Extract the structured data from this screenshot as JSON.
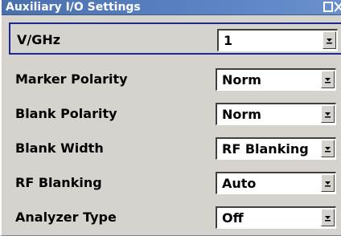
{
  "window": {
    "title": "Auxiliary I/O Settings"
  },
  "settings": [
    {
      "label": "V/GHz",
      "value": "1",
      "focused": true
    },
    {
      "label": "Marker Polarity",
      "value": "Norm",
      "focused": false
    },
    {
      "label": "Blank Polarity",
      "value": "Norm",
      "focused": false
    },
    {
      "label": "Blank Width",
      "value": "RF Blanking",
      "focused": false
    },
    {
      "label": "RF Blanking",
      "value": "Auto",
      "focused": false
    },
    {
      "label": "Analyzer Type",
      "value": "Off",
      "focused": false
    }
  ],
  "colors": {
    "titlebar": "#5b83c4",
    "panel": "#d6d3ce",
    "focus_border": "#1a2a8c"
  },
  "icons": {
    "restore": "window-restore-icon",
    "close": "close-icon",
    "dropdown": "chevron-down-icon"
  }
}
